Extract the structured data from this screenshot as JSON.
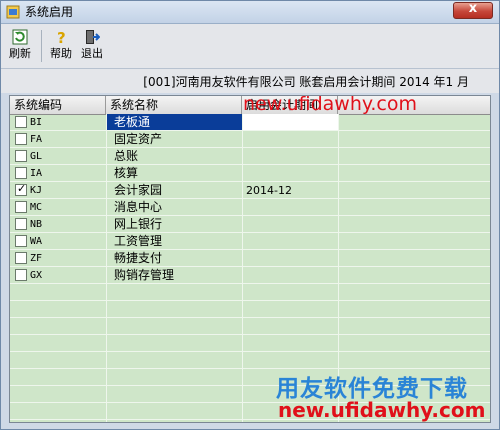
{
  "window": {
    "title": "系统启用",
    "close_label": "x"
  },
  "toolbar": {
    "items": [
      {
        "label": "刷新",
        "icon": "refresh-icon"
      },
      {
        "label": "帮助",
        "icon": "help-icon"
      },
      {
        "label": "退出",
        "icon": "exit-icon"
      }
    ]
  },
  "info": {
    "text": "[001]河南用友软件有限公司 账套启用会计期间 2014 年1 月"
  },
  "table": {
    "columns": [
      "系统编码",
      "系统名称",
      "启用会计期间"
    ],
    "rows": [
      {
        "code": "BI",
        "name": "老板通",
        "period": "",
        "checked": false,
        "selected": true
      },
      {
        "code": "FA",
        "name": "固定资产",
        "period": "",
        "checked": false,
        "selected": false
      },
      {
        "code": "GL",
        "name": "总账",
        "period": "",
        "checked": false,
        "selected": false
      },
      {
        "code": "IA",
        "name": "核算",
        "period": "",
        "checked": false,
        "selected": false
      },
      {
        "code": "KJ",
        "name": "会计家园",
        "period": "2014-12",
        "checked": true,
        "selected": false
      },
      {
        "code": "MC",
        "name": "消息中心",
        "period": "",
        "checked": false,
        "selected": false
      },
      {
        "code": "NB",
        "name": "网上银行",
        "period": "",
        "checked": false,
        "selected": false
      },
      {
        "code": "WA",
        "name": "工资管理",
        "period": "",
        "checked": false,
        "selected": false
      },
      {
        "code": "ZF",
        "name": "畅捷支付",
        "period": "",
        "checked": false,
        "selected": false
      },
      {
        "code": "GX",
        "name": "购销存管理",
        "period": "",
        "checked": false,
        "selected": false
      }
    ]
  },
  "watermarks": {
    "top": "new.ufidawhy.com",
    "bottom_cn": "用友软件免费下载",
    "bottom_url": "new.ufidawhy.com"
  },
  "colors": {
    "grid_bg": "#cfe6c9",
    "selection": "#0a3d99",
    "watermark_red": "#e0101a",
    "watermark_blue": "#2a84d6"
  }
}
